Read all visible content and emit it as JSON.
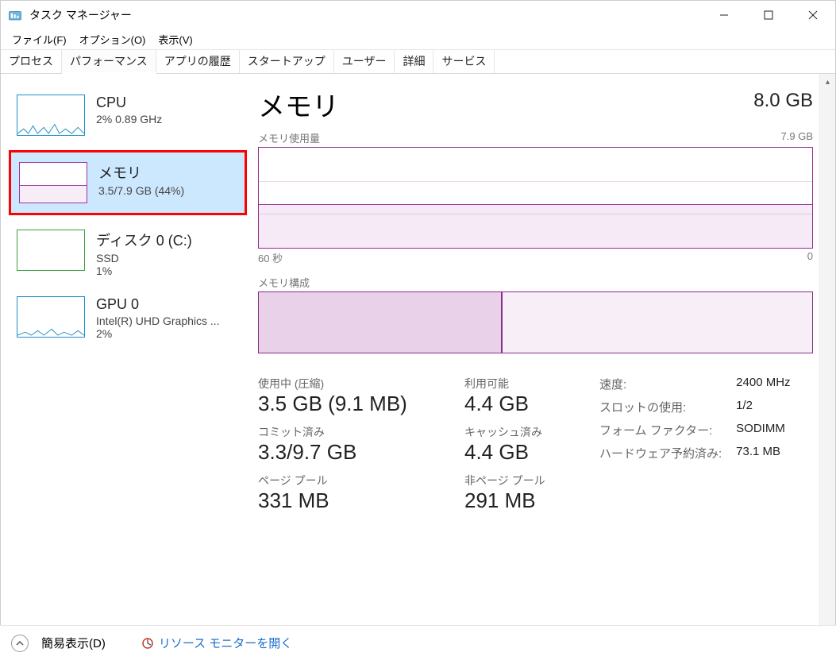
{
  "window": {
    "title": "タスク マネージャー"
  },
  "menubar": [
    "ファイル(F)",
    "オプション(O)",
    "表示(V)"
  ],
  "tabs": [
    "プロセス",
    "パフォーマンス",
    "アプリの履歴",
    "スタートアップ",
    "ユーザー",
    "詳細",
    "サービス"
  ],
  "active_tab": 1,
  "sidebar": {
    "items": [
      {
        "title": "CPU",
        "sub": "2%  0.89 GHz",
        "kind": "cpu"
      },
      {
        "title": "メモリ",
        "sub": "3.5/7.9 GB (44%)",
        "kind": "mem",
        "selected": true
      },
      {
        "title": "ディスク 0 (C:)",
        "sub": "SSD",
        "sub2": "1%",
        "kind": "disk"
      },
      {
        "title": "GPU 0",
        "sub": "Intel(R) UHD Graphics ...",
        "sub2": "2%",
        "kind": "gpu"
      }
    ]
  },
  "main": {
    "title": "メモリ",
    "total": "8.0 GB",
    "usage_label": "メモリ使用量",
    "usage_max": "7.9 GB",
    "x_left": "60 秒",
    "x_right": "0",
    "comp_label": "メモリ構成",
    "stats_left": [
      {
        "lbl": "使用中 (圧縮)",
        "val": "3.5 GB (9.1 MB)"
      },
      {
        "lbl": "コミット済み",
        "val": "3.3/9.7 GB"
      },
      {
        "lbl": "ページ プール",
        "val": "331 MB"
      }
    ],
    "stats_mid": [
      {
        "lbl": "利用可能",
        "val": "4.4 GB"
      },
      {
        "lbl": "キャッシュ済み",
        "val": "4.4 GB"
      },
      {
        "lbl": "非ページ プール",
        "val": "291 MB"
      }
    ],
    "kv": [
      {
        "k": "速度:",
        "v": "2400 MHz"
      },
      {
        "k": "スロットの使用:",
        "v": "1/2"
      },
      {
        "k": "フォーム ファクター:",
        "v": "SODIMM"
      },
      {
        "k": "ハードウェア予約済み:",
        "v": "73.1 MB"
      }
    ]
  },
  "footer": {
    "simple_view": "簡易表示(D)",
    "resource_monitor": "リソース モニターを開く"
  },
  "chart_data": {
    "type": "area",
    "title": "メモリ使用量",
    "xlabel": "60 秒 → 0",
    "ylabel": "GB",
    "ylim": [
      0,
      7.9
    ],
    "series": [
      {
        "name": "使用中",
        "value_gb": 3.5,
        "percent": 44
      }
    ],
    "composition": {
      "total_gb": 7.9,
      "in_use_gb": 3.5,
      "available_gb": 4.4
    }
  }
}
